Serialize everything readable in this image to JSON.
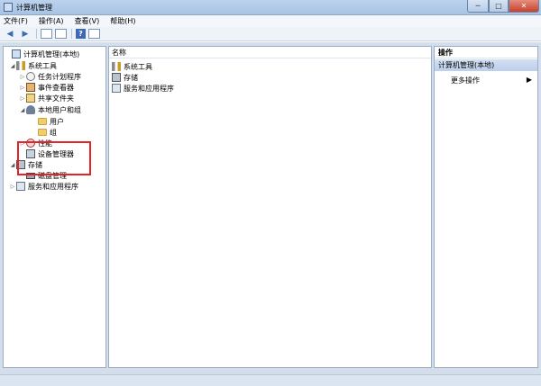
{
  "window": {
    "title": "计算机管理"
  },
  "menu": [
    "文件(F)",
    "操作(A)",
    "查看(V)",
    "帮助(H)"
  ],
  "tree": [
    {
      "label": "计算机管理(本地)",
      "expander": "",
      "icon": "computer-icon"
    },
    {
      "label": "系统工具",
      "expander": "◢",
      "icon": "tools-icon"
    },
    {
      "label": "任务计划程序",
      "expander": "▷",
      "icon": "clock-icon"
    },
    {
      "label": "事件查看器",
      "expander": "▷",
      "icon": "event-viewer-icon"
    },
    {
      "label": "共享文件夹",
      "expander": "▷",
      "icon": "shared-folder-icon"
    },
    {
      "label": "本地用户和组",
      "expander": "◢",
      "icon": "users-icon"
    },
    {
      "label": "用户",
      "expander": "",
      "icon": "folder-icon"
    },
    {
      "label": "组",
      "expander": "",
      "icon": "folder-icon"
    },
    {
      "label": "性能",
      "expander": "▷",
      "icon": "performance-icon"
    },
    {
      "label": "设备管理器",
      "expander": "",
      "icon": "device-manager-icon"
    },
    {
      "label": "存储",
      "expander": "◢",
      "icon": "storage-icon"
    },
    {
      "label": "磁盘管理",
      "expander": "",
      "icon": "disk-icon"
    },
    {
      "label": "服务和应用程序",
      "expander": "▷",
      "icon": "services-icon"
    }
  ],
  "list": {
    "column_header": "名称",
    "items": [
      "系统工具",
      "存储",
      "服务和应用程序"
    ]
  },
  "actions": {
    "title": "操作",
    "section": "计算机管理(本地)",
    "items": [
      "更多操作"
    ]
  },
  "colors": {
    "highlight": "#e0242a",
    "pane_bg": "#ffffff",
    "frame": "#d4deeb"
  }
}
